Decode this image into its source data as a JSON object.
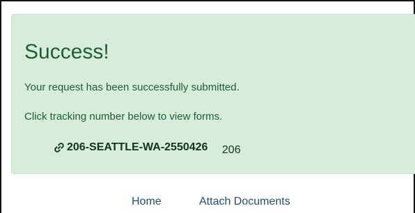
{
  "alert": {
    "heading": "Success!",
    "message": "Your request has been successfully submitted.",
    "instruction": "Click tracking number below to view forms.",
    "tracking_icon": "link-icon",
    "tracking_number": "206-SEATTLE-WA-2550426",
    "area_code": "206"
  },
  "nav": {
    "home_label": "Home",
    "attach_label": "Attach Documents"
  },
  "colors": {
    "alert_background": "#d6eddb",
    "alert_text": "#1d5e30",
    "link": "#1f4d78"
  }
}
